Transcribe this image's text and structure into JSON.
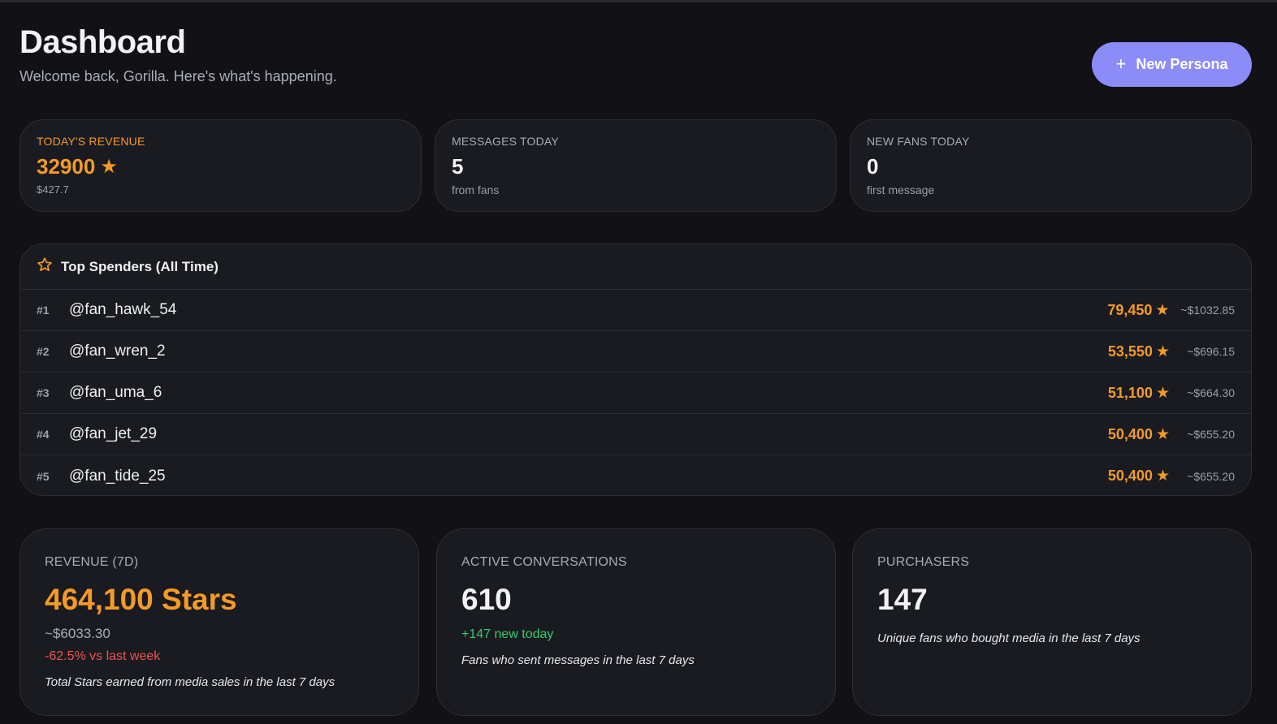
{
  "header": {
    "title": "Dashboard",
    "subtitle": "Welcome back, Gorilla. Here's what's happening.",
    "new_persona_label": "New Persona",
    "new_persona_icon": "plus-icon"
  },
  "stats": {
    "revenue_today": {
      "label": "TODAY'S REVENUE",
      "value": "32900",
      "sub": "$427.7",
      "icon": "star-icon"
    },
    "messages_today": {
      "label": "MESSAGES TODAY",
      "value": "5",
      "sub": "from fans"
    },
    "new_fans_today": {
      "label": "NEW FANS TODAY",
      "value": "0",
      "sub": "first message"
    }
  },
  "top_spenders": {
    "title": "Top Spenders (All Time)",
    "icon": "star-outline-icon",
    "rows": [
      {
        "rank": "#1",
        "handle": "@fan_hawk_54",
        "stars": "79,450",
        "usd": "~$1032.85"
      },
      {
        "rank": "#2",
        "handle": "@fan_wren_2",
        "stars": "53,550",
        "usd": "~$696.15"
      },
      {
        "rank": "#3",
        "handle": "@fan_uma_6",
        "stars": "51,100",
        "usd": "~$664.30"
      },
      {
        "rank": "#4",
        "handle": "@fan_jet_29",
        "stars": "50,400",
        "usd": "~$655.20"
      },
      {
        "rank": "#5",
        "handle": "@fan_tide_25",
        "stars": "50,400",
        "usd": "~$655.20"
      }
    ]
  },
  "weekly": {
    "revenue": {
      "label": "REVENUE (7D)",
      "value": "464,100 Stars",
      "usd": "~$6033.30",
      "delta": "-62.5% vs last week",
      "desc": "Total Stars earned from media sales in the last 7 days"
    },
    "conversations": {
      "label": "ACTIVE CONVERSATIONS",
      "value": "610",
      "delta": "+147 new today",
      "desc": "Fans who sent messages in the last 7 days"
    },
    "purchasers": {
      "label": "PURCHASERS",
      "value": "147",
      "desc": "Unique fans who bought media in the last 7 days"
    }
  },
  "colors": {
    "background": "#121216",
    "card": "#1a1b20",
    "accent": "#8b8cf8",
    "stars": "#f39a27",
    "positive": "#2ecc71",
    "negative": "#f05252"
  }
}
